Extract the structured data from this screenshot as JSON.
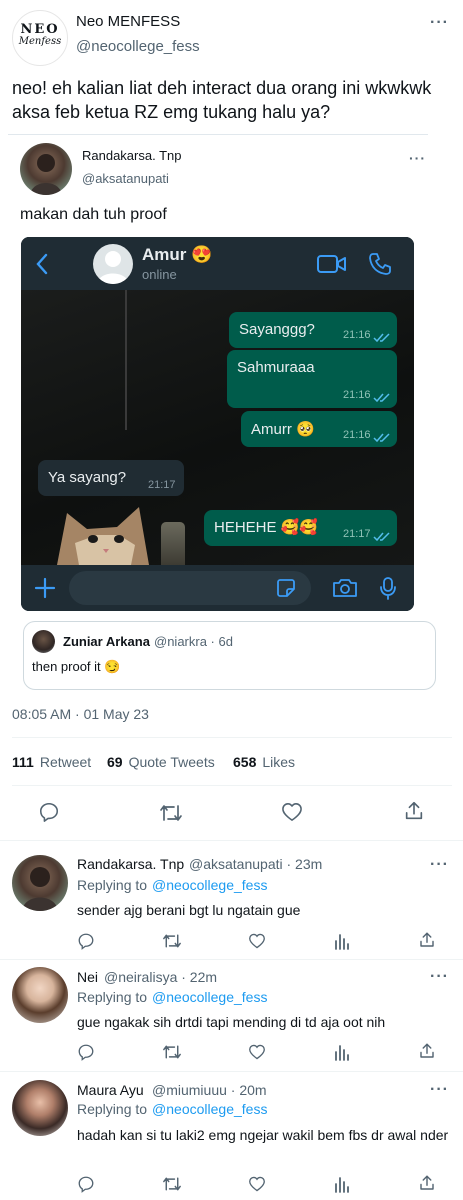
{
  "main_tweet": {
    "account_name": "Neo MENFESS",
    "handle": "@neocollege_fess",
    "logo_text_top": "NEO",
    "logo_text_bottom": "Menfess",
    "text": "neo! eh kalian liat deh interact dua orang ini wkwkwk aksa feb ketua RZ emg tukang halu ya?",
    "timestamp": "08:05 AM · 01 May 23"
  },
  "quoted_tweet": {
    "name": "Randakarsa. Tnp",
    "handle": "@aksatanupati",
    "text": "makan dah tuh proof"
  },
  "chat_screenshot": {
    "contact_name": "Amur 😍",
    "status": "online",
    "messages": [
      {
        "direction": "out",
        "text": "Sayanggg?",
        "time": "21:16"
      },
      {
        "direction": "out",
        "text": "Sahmuraaa",
        "time": "21:16"
      },
      {
        "direction": "out",
        "text": "Amurr 🥺",
        "time": "21:16"
      },
      {
        "direction": "in",
        "text": "Ya sayang?",
        "time": "21:17"
      },
      {
        "direction": "out",
        "text": "HEHEHE 🥰🥰",
        "time": "21:17"
      }
    ]
  },
  "nested_quote": {
    "name": "Zuniar Arkana",
    "meta": "@niarkra · 6d",
    "text": "then proof it 😏"
  },
  "stats": {
    "retweets_count": "111",
    "retweets_label": "Retweet",
    "quotes_count": "69",
    "quotes_label": "Quote Tweets",
    "likes_count": "658",
    "likes_label": "Likes"
  },
  "replies": [
    {
      "name": "Randakarsa. Tnp",
      "meta": "@aksatanupati · 23m",
      "replying_prefix": "Replying to",
      "replying_handle": "@neocollege_fess",
      "text": "sender ajg berani bgt lu ngatain gue"
    },
    {
      "name": "Nei",
      "meta": "@neiralisya · 22m",
      "replying_prefix": "Replying to",
      "replying_handle": "@neocollege_fess",
      "text": "gue ngakak sih drtdi tapi mending di td aja oot nih"
    },
    {
      "name": "Maura Ayu",
      "meta": "@miumiuuu · 20m",
      "replying_prefix": "Replying to",
      "replying_handle": "@neocollege_fess",
      "text": "hadah kan si tu laki2 emg ngejar wakil bem fbs dr awal nder"
    }
  ],
  "colors": {
    "link_blue": "#1d9bf0",
    "muted_gray": "#536471",
    "wa_outgoing": "#005c4b",
    "wa_incoming": "#202c33",
    "wa_header": "#1f2c34"
  },
  "icons": [
    "more-dots-icon",
    "reply-icon",
    "retweet-icon",
    "like-icon",
    "share-icon",
    "analytics-icon",
    "back-chevron-icon",
    "video-call-icon",
    "phone-icon",
    "plus-icon",
    "sticker-icon",
    "camera-icon",
    "mic-icon",
    "read-receipt-icon"
  ]
}
